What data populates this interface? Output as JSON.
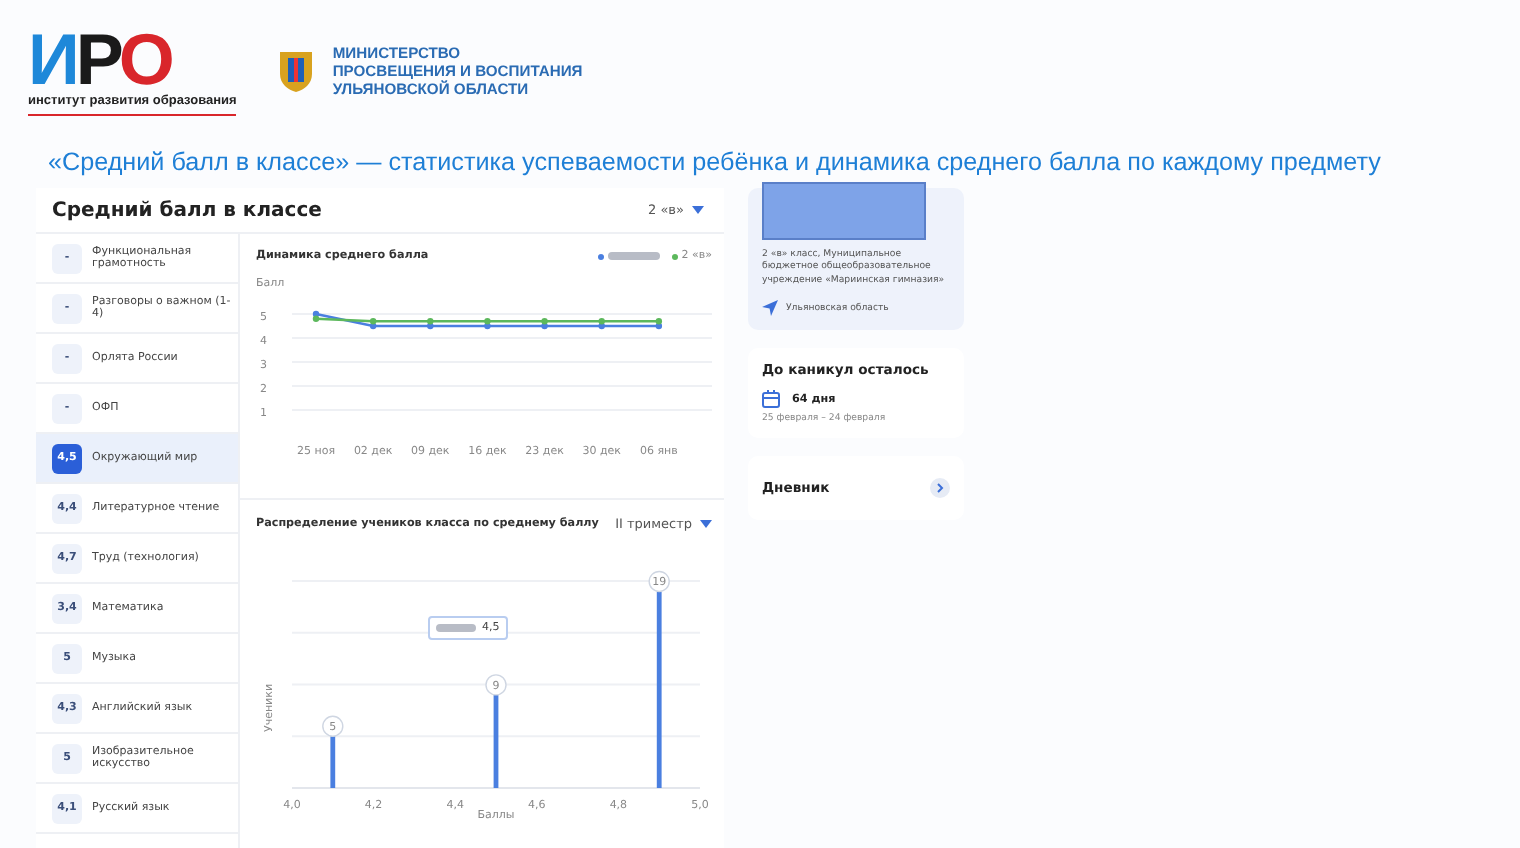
{
  "header": {
    "logo": {
      "letters": [
        {
          "text": "И",
          "color": "#1e88d9"
        },
        {
          "text": "Р",
          "color": "#1a1a1a"
        },
        {
          "text": "О",
          "color": "#d9262b"
        }
      ],
      "caption": "институт развития образования"
    },
    "ministry": [
      "МИНИСТЕРСТВО",
      "ПРОСВЕЩЕНИЯ И ВОСПИТАНИЯ",
      "УЛЬЯНОВСКОЙ ОБЛАСТИ"
    ]
  },
  "slide_title": "«Средний балл в классе» — статистика успеваемости ребёнка и динамика среднего балла по каждому предмету",
  "dashboard": {
    "title": "Средний балл в классе",
    "class_select": "2 «в»",
    "subjects": [
      {
        "score": "-",
        "name": "Функциональная грамотность",
        "selected": false
      },
      {
        "score": "-",
        "name": "Разговоры о важном (1-4)",
        "selected": false
      },
      {
        "score": "-",
        "name": "Орлята России",
        "selected": false
      },
      {
        "score": "-",
        "name": "ОФП",
        "selected": false
      },
      {
        "score": "4,5",
        "name": "Окружающий мир",
        "selected": true
      },
      {
        "score": "4,4",
        "name": "Литературное чтение",
        "selected": false
      },
      {
        "score": "4,7",
        "name": "Труд (технология)",
        "selected": false
      },
      {
        "score": "3,4",
        "name": "Математика",
        "selected": false
      },
      {
        "score": "5",
        "name": "Музыка",
        "selected": false
      },
      {
        "score": "4,3",
        "name": "Английский язык",
        "selected": false
      },
      {
        "score": "5",
        "name": "Изобразительное искусство",
        "selected": false
      },
      {
        "score": "4,1",
        "name": "Русский язык",
        "selected": false
      }
    ],
    "trend": {
      "title": "Динамика среднего балла",
      "chart_data": {
        "type": "line",
        "grid": true,
        "ylabel": "Балл",
        "categories": [
          "25 ноя",
          "02 дек",
          "09 дек",
          "16 дек",
          "23 дек",
          "30 дек",
          "06 янв"
        ],
        "ylim": [
          1,
          5
        ],
        "yticks": [
          1,
          2,
          3,
          4,
          5
        ],
        "series": [
          {
            "color": "#4a7fe0",
            "marker": true,
            "values": [
              5,
              4.5,
              4.5,
              4.5,
              4.5,
              4.5,
              4.5
            ]
          },
          {
            "name": "2 «в»",
            "color": "#5cb85c",
            "marker": true,
            "values": [
              4.8,
              4.7,
              4.7,
              4.7,
              4.7,
              4.7,
              4.7
            ]
          }
        ]
      }
    },
    "distribution": {
      "title": "Распределение учеников класса по среднему баллу",
      "period_select": "II триместр",
      "chart_data": {
        "type": "bar",
        "xlabel": "Баллы",
        "ylabel": "Ученики",
        "x": [
          4.1,
          4.5,
          4.9
        ],
        "values": [
          5,
          9,
          19
        ],
        "xlim": [
          4.0,
          5.0
        ],
        "xticks": [
          {
            "value": 4.0,
            "label": "4,0"
          },
          {
            "value": 4.2,
            "label": "4,2"
          },
          {
            "value": 4.4,
            "label": "4,4"
          },
          {
            "value": 4.6,
            "label": "4,6"
          },
          {
            "value": 4.8,
            "label": "4,8"
          },
          {
            "value": 5.0,
            "label": "5,0"
          }
        ],
        "data_labels": true,
        "annotations": [
          "4,5"
        ]
      }
    }
  },
  "side": {
    "student": {
      "class_info": "2 «в» класс, Муниципальное бюджетное общеобразовательное учреждение «Мариинская гимназия»",
      "region": "Ульяновская область"
    },
    "holidays": {
      "title": "До каникул осталось",
      "days": "64 дня",
      "range": "25 февраля – 24 февраля"
    },
    "diary": {
      "title": "Дневник"
    }
  }
}
